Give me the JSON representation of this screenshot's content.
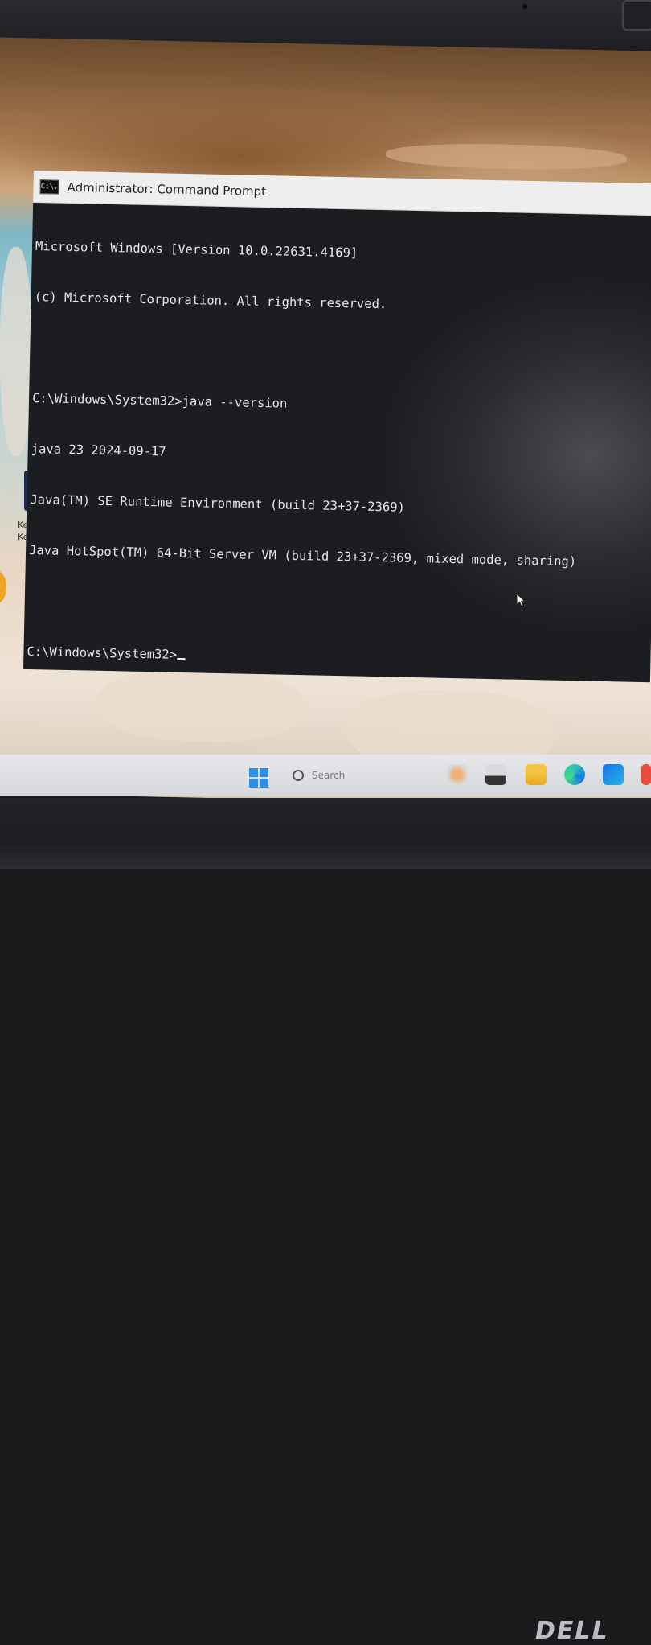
{
  "window": {
    "title": "Administrator: Command Prompt",
    "icon_label": "C:\\."
  },
  "console": {
    "lines": [
      "Microsoft Windows [Version 10.0.22631.4169]",
      "(c) Microsoft Corporation. All rights reserved.",
      "",
      "C:\\Windows\\System32>java --version",
      "java 23 2024-09-17",
      "Java(TM) SE Runtime Environment (build 23+37-2369)",
      "Java HotSpot(TM) 64-Bit Server VM (build 23+37-2369, mixed mode, sharing)",
      "",
      "C:\\Windows\\System32>"
    ]
  },
  "desktop": {
    "icon_label_1": "Keyb",
    "icon_label_2": "Keys C"
  },
  "taskbar": {
    "search_placeholder": "Search"
  },
  "brand": "DELL"
}
